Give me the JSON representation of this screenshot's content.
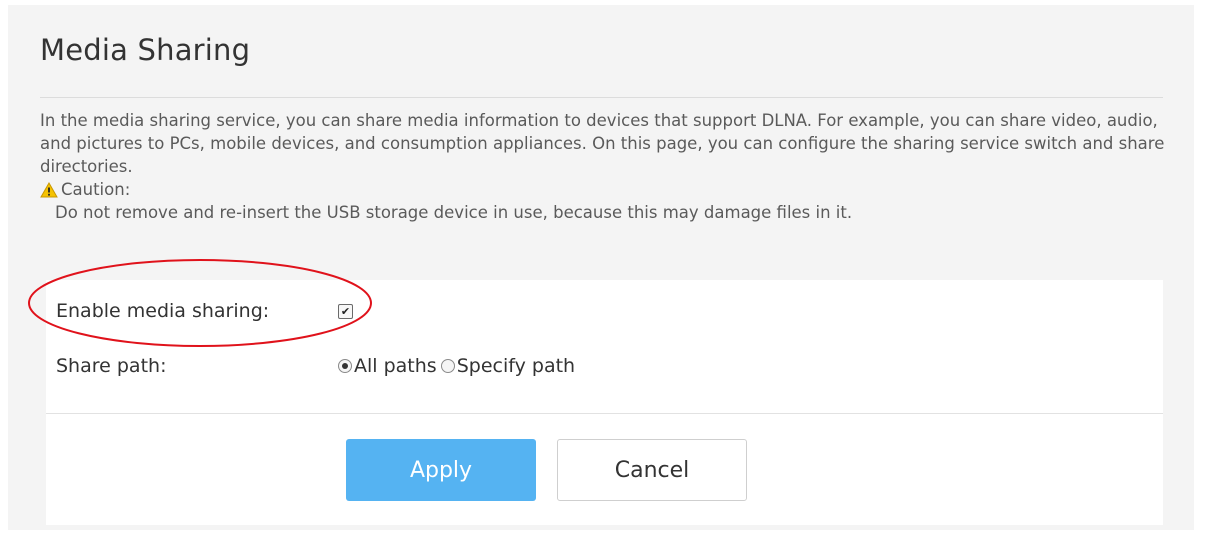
{
  "page": {
    "title": "Media Sharing",
    "description": "In the media sharing service, you can share media information to devices that support DLNA. For example, you can share video, audio, and pictures to PCs, mobile devices, and consumption appliances. On this page, you can configure the sharing service switch and share directories.",
    "caution_label": "Caution:",
    "caution_text": "Do not remove and re-insert the USB storage device in use, because this may damage files in it."
  },
  "form": {
    "enable_label": "Enable media sharing:",
    "enable_checked": true,
    "share_path_label": "Share path:",
    "share_path_options": [
      {
        "label": "All paths",
        "selected": true
      },
      {
        "label": "Specify path",
        "selected": false
      }
    ]
  },
  "actions": {
    "apply_label": "Apply",
    "cancel_label": "Cancel"
  },
  "colors": {
    "accent": "#55b3f2",
    "highlight": "#e0121b",
    "warning": "#f5c200"
  },
  "icons": {
    "caution": "warning-triangle-icon",
    "checkbox": "check-icon"
  }
}
